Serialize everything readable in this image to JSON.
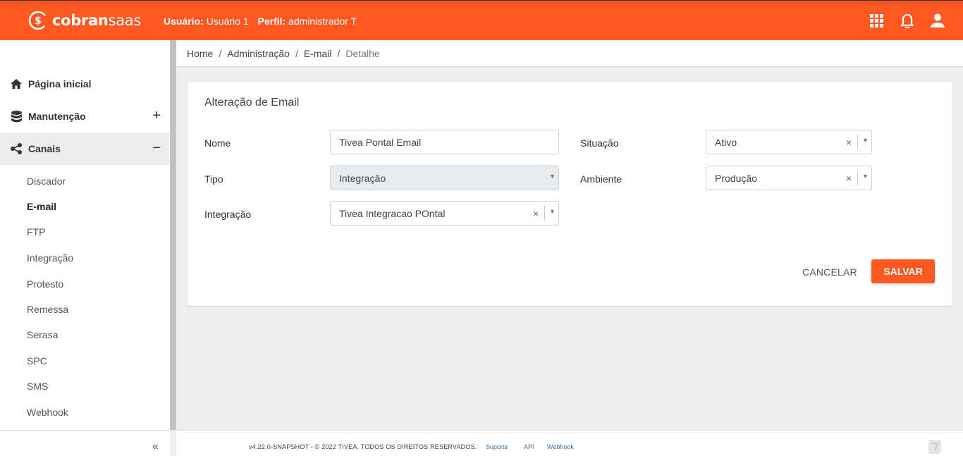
{
  "header": {
    "logo_prefix": "cobran",
    "logo_suffix": "saas",
    "user_label": "Usuário:",
    "user_value": "Usuário 1",
    "profile_label": "Perfil:",
    "profile_value": "administrador T",
    "icons": [
      "apps-grid-icon",
      "bell-icon",
      "user-icon"
    ]
  },
  "sidebar": {
    "menu": [
      {
        "label": "Página inicial",
        "icon": "home-icon",
        "toggle": ""
      },
      {
        "label": "Manutenção",
        "icon": "database-icon",
        "toggle": "+"
      },
      {
        "label": "Canais",
        "icon": "share-icon",
        "toggle": "−"
      }
    ],
    "subitems": [
      "Discador",
      "E-mail",
      "FTP",
      "Integração",
      "Protesto",
      "Remessa",
      "Serasa",
      "SPC",
      "SMS",
      "Webhook"
    ],
    "collapse": "«"
  },
  "breadcrumb": {
    "items": [
      "Home",
      "Administração",
      "E-mail",
      "Detalhe"
    ],
    "separator": "/"
  },
  "form": {
    "title": "Alteração de Email",
    "nome_label": "Nome",
    "nome_value": "Tivea Pontal Email",
    "tipo_label": "Tipo",
    "tipo_value": "Integração",
    "integracao_label": "Integração",
    "integracao_value": "Tivea Integracao POntal",
    "situacao_label": "Situação",
    "situacao_value": "Ativo",
    "ambiente_label": "Ambiente",
    "ambiente_value": "Produção",
    "clear_glyph": "×",
    "caret_glyph": "▼",
    "cancel_label": "CANCELAR",
    "save_label": "SALVAR"
  },
  "footer": {
    "copyright": "v4.22.0-SNAPSHOT - © 2022 TIVEA. TODOS OS DIREITOS RESERVADOS.",
    "links": [
      "Suporte",
      "API",
      "Webhook"
    ]
  },
  "colors": {
    "brand": "#ff5722",
    "active_menu": "#ececec"
  }
}
